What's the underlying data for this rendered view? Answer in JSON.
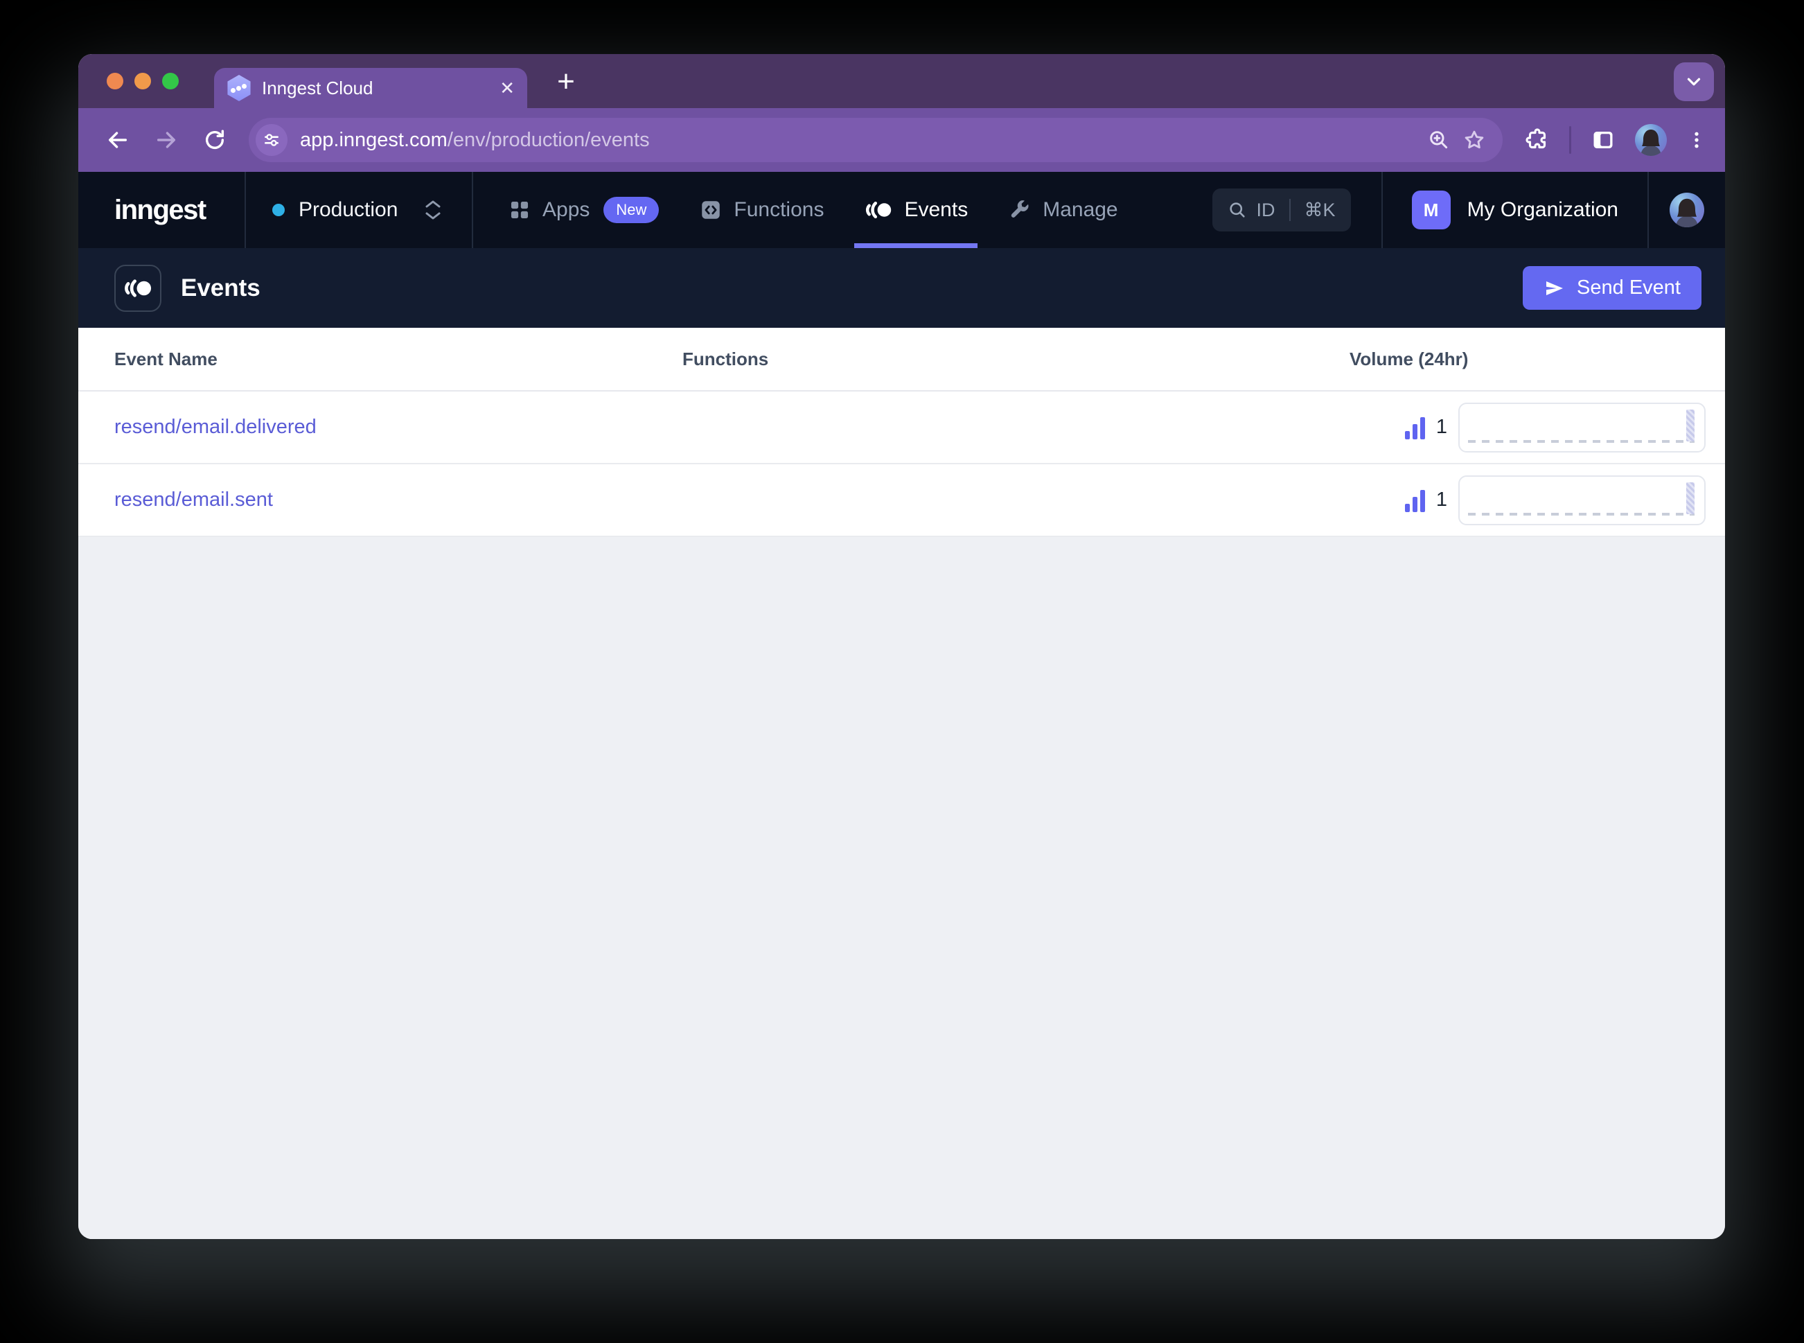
{
  "browser": {
    "tab_title": "Inngest Cloud",
    "url_host": "app.inngest.com",
    "url_path": "/env/production/events",
    "icons": {
      "traffic_lights": [
        "close",
        "minimize",
        "zoom"
      ],
      "toolbar": [
        "back-arrow",
        "forward-arrow",
        "reload",
        "tune",
        "zoom-in",
        "bookmark-star",
        "extension-puzzle",
        "side-panel",
        "profile-avatar",
        "kebab-menu"
      ],
      "tab": [
        "inngest-hexagon-favicon",
        "close-x",
        "new-tab-plus",
        "tab-search-chevron"
      ]
    },
    "colors": {
      "tabstrip_bg": "#4A3562",
      "toolbar_bg": "#6F51A1",
      "traffic_close": "#EF8950",
      "traffic_min": "#F09A4A",
      "traffic_zoom": "#33C748"
    }
  },
  "nav": {
    "logo": "inngest",
    "env_selector": {
      "label": "Production",
      "dot_color": "#2EB0E6"
    },
    "items": [
      {
        "label": "Apps",
        "badge": "New",
        "icon": "grid-squares"
      },
      {
        "label": "Functions",
        "badge": "",
        "icon": "code-box"
      },
      {
        "label": "Events",
        "badge": "",
        "icon": "event-stream",
        "active": true
      },
      {
        "label": "Manage",
        "badge": "",
        "icon": "wrench"
      }
    ],
    "search": {
      "id_label": "ID",
      "shortcut": "⌘K",
      "icon": "search-magnifier"
    },
    "organization": {
      "badge": "M",
      "name": "My Organization",
      "badge_color": "#6E6CF8"
    },
    "colors": {
      "bg": "#0A101E",
      "accent": "#6366F1",
      "active_underline": "#7477F3"
    }
  },
  "page": {
    "title": "Events",
    "icon": "event-stream",
    "send_button": {
      "label": "Send Event",
      "icon": "send-plane",
      "color": "#6469F1"
    }
  },
  "table": {
    "columns": [
      "Event Name",
      "Functions",
      "Volume (24hr)"
    ],
    "rows": [
      {
        "name": "resend/email.delivered",
        "functions": "",
        "volume": "1"
      },
      {
        "name": "resend/email.sent",
        "functions": "",
        "volume": "1"
      }
    ],
    "link_color": "#5A5CD6"
  },
  "chart_data": [
    {
      "type": "bar",
      "title": "resend/email.delivered volume (24hr sparkline)",
      "categories": [
        "24hr window, hourly buckets"
      ],
      "values_note": "flat zero baseline with a single bar of height 1 in the most recent bucket",
      "total_volume": 1,
      "legend_position": "none",
      "grid": false
    },
    {
      "type": "bar",
      "title": "resend/email.sent volume (24hr sparkline)",
      "categories": [
        "24hr window, hourly buckets"
      ],
      "values_note": "flat zero baseline with a single bar of height 1 in the most recent bucket",
      "total_volume": 1,
      "legend_position": "none",
      "grid": false
    }
  ]
}
